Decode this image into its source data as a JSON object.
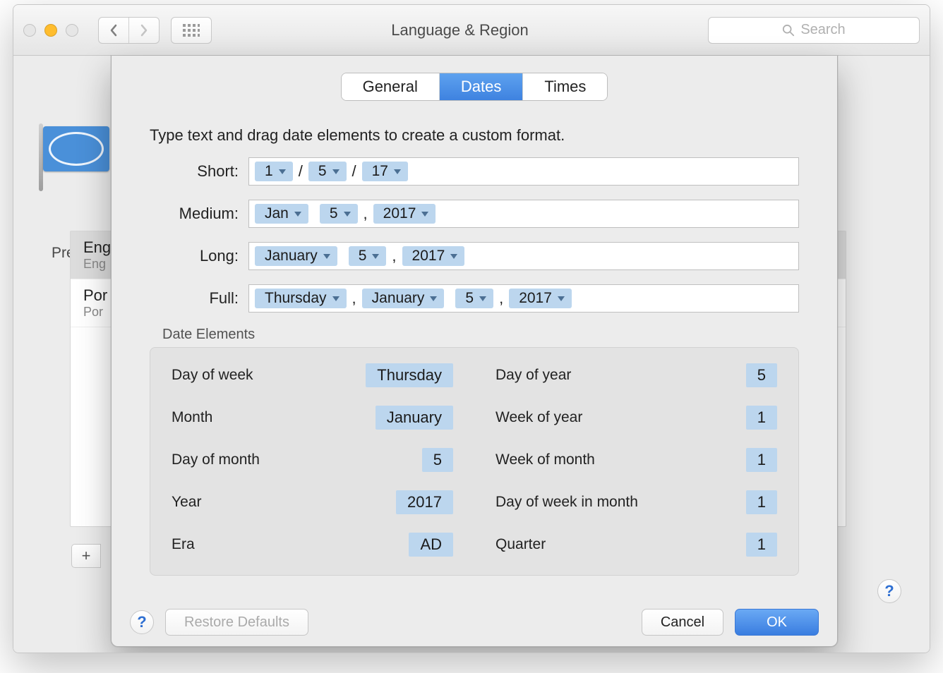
{
  "toolbar": {
    "title": "Language & Region",
    "search_placeholder": "Search"
  },
  "background": {
    "preferred_heading": "Pref",
    "rows": [
      {
        "title": "Eng",
        "subtitle": "Eng",
        "selected": true
      },
      {
        "title": "Por",
        "subtitle": "Por",
        "selected": false
      }
    ]
  },
  "tabs": {
    "general": "General",
    "dates": "Dates",
    "times": "Times",
    "active": "dates"
  },
  "instruction": "Type text and drag date elements to create a custom format.",
  "formats": {
    "short": {
      "label": "Short:",
      "tokens": [
        "1",
        "5",
        "17"
      ],
      "seps": [
        "/",
        "/"
      ]
    },
    "medium": {
      "label": "Medium:",
      "tokens": [
        "Jan",
        "5",
        "2017"
      ],
      "seps": [
        "",
        ","
      ]
    },
    "long": {
      "label": "Long:",
      "tokens": [
        "January",
        "5",
        "2017"
      ],
      "seps": [
        "",
        ","
      ]
    },
    "full": {
      "label": "Full:",
      "tokens": [
        "Thursday",
        "January",
        "5",
        "2017"
      ],
      "seps": [
        ",",
        "",
        ","
      ]
    }
  },
  "elements": {
    "title": "Date Elements",
    "left": [
      {
        "label": "Day of week",
        "value": "Thursday"
      },
      {
        "label": "Month",
        "value": "January"
      },
      {
        "label": "Day of month",
        "value": "5"
      },
      {
        "label": "Year",
        "value": "2017"
      },
      {
        "label": "Era",
        "value": "AD"
      }
    ],
    "right": [
      {
        "label": "Day of year",
        "value": "5"
      },
      {
        "label": "Week of year",
        "value": "1"
      },
      {
        "label": "Week of month",
        "value": "1"
      },
      {
        "label": "Day of week in month",
        "value": "1"
      },
      {
        "label": "Quarter",
        "value": "1"
      }
    ]
  },
  "footer": {
    "restore": "Restore Defaults",
    "cancel": "Cancel",
    "ok": "OK"
  }
}
